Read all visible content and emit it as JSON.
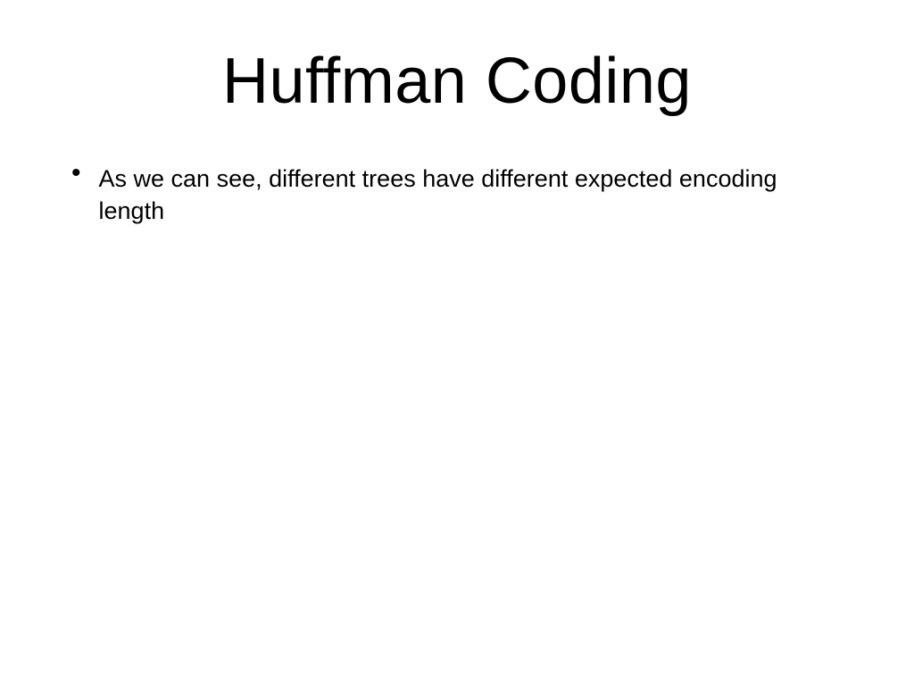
{
  "slide": {
    "title": "Huffman Coding",
    "bullets": [
      {
        "text": "As we can see, different trees have different expected encoding length"
      }
    ]
  }
}
